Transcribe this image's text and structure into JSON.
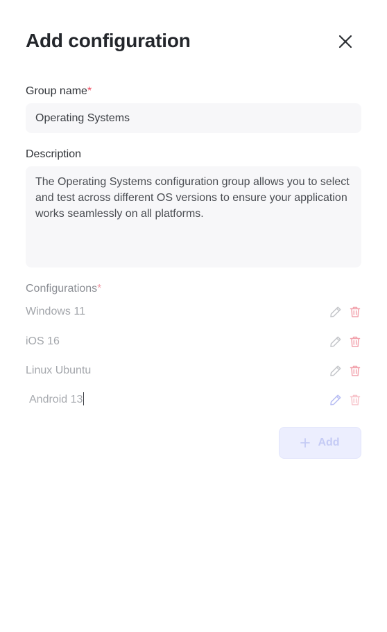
{
  "dialog": {
    "title": "Add configuration"
  },
  "group_name": {
    "label": "Group name",
    "required_mark": "*",
    "value": "Operating Systems"
  },
  "description": {
    "label": "Description",
    "value": "The Operating Systems configuration group allows you to select and test across different OS versions to ensure your application works seamlessly on all platforms."
  },
  "configurations": {
    "label": "Configurations",
    "required_mark": "*",
    "items": [
      {
        "name": "Windows 11"
      },
      {
        "name": "iOS 16"
      },
      {
        "name": "Linux Ubuntu"
      },
      {
        "name": "Android 13"
      }
    ],
    "editing_index": 3
  },
  "actions": {
    "add_label": "Add"
  },
  "icons": {
    "close": "close-icon",
    "edit": "pencil-icon",
    "delete": "trash-icon",
    "add": "plus-icon"
  },
  "colors": {
    "required": "#ef4f63",
    "edit_icon": "#c4c6ca",
    "edit_icon_active": "#b7bdf3",
    "delete_icon": "#f2a3ad",
    "add_button_bg": "#eceefe",
    "add_button_text": "#c5cbf5"
  }
}
